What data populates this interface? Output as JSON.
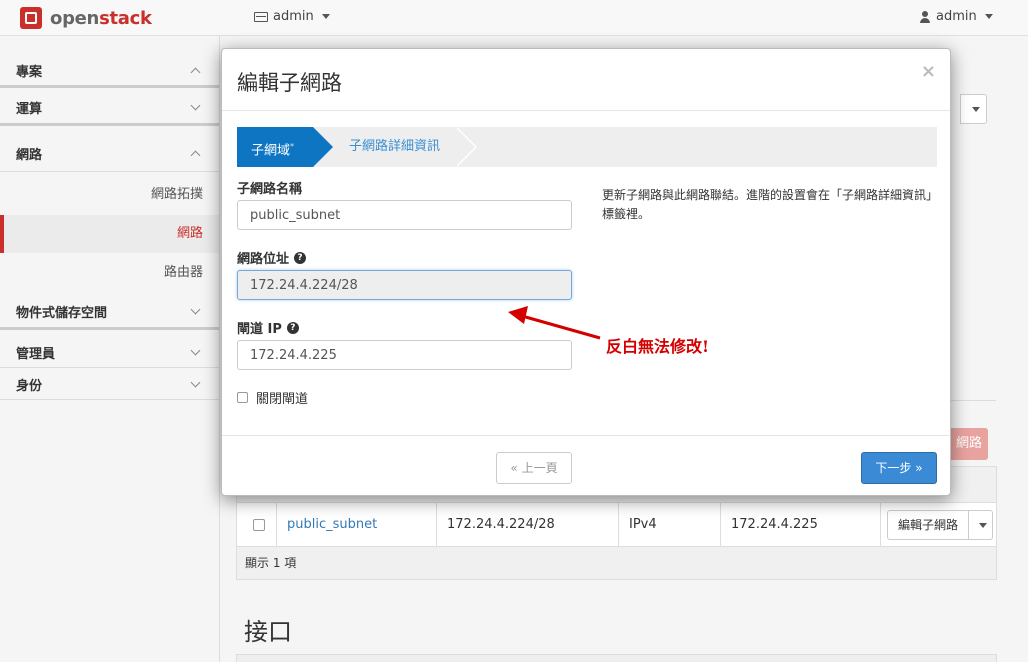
{
  "navbar": {
    "brand_prefix": "open",
    "brand_suffix": "stack",
    "project_label": "admin",
    "user_label": "admin"
  },
  "sidebar": {
    "groups": [
      {
        "label": "專案",
        "icon": "chevron-up-icon"
      },
      {
        "label": "運算",
        "icon": "chevron-down-icon"
      },
      {
        "label": "網路",
        "icon": "chevron-up-icon"
      },
      {
        "label": "物件式儲存空間",
        "icon": "chevron-down-icon"
      },
      {
        "label": "管理員",
        "icon": "chevron-down-icon"
      },
      {
        "label": "身份",
        "icon": "chevron-down-icon"
      }
    ],
    "network_items": [
      {
        "label": "網路拓撲",
        "active": false
      },
      {
        "label": "網路",
        "active": true
      },
      {
        "label": "路由器",
        "active": false
      }
    ]
  },
  "background": {
    "action_btn_fragment": "網路",
    "subnet_row": {
      "name": "public_subnet",
      "network_address": "172.24.4.224/28",
      "ip_version": "IPv4",
      "gateway_ip": "172.24.4.225",
      "action_label": "編輯子網路"
    },
    "footer_text": "顯示 1 項",
    "ports_heading": "接口"
  },
  "modal": {
    "title": "編輯子網路",
    "close_label": "×",
    "wizard_steps": [
      {
        "label": "子網域",
        "active": true,
        "required_mark": "*"
      },
      {
        "label": "子網路詳細資訊",
        "active": false
      }
    ],
    "fields": {
      "subnet_name": {
        "label": "子網路名稱",
        "value": "public_subnet"
      },
      "network_address": {
        "label": "網路位址",
        "value": "172.24.4.224/28",
        "disabled": true
      },
      "gateway_ip": {
        "label": "閘道 IP",
        "value": "172.24.4.225"
      },
      "disable_gateway": {
        "label": "關閉閘道",
        "checked": false
      }
    },
    "help_text": "更新子網路與此網路聯結。進階的設置會在「子網路詳細資訊」標籤裡。",
    "buttons": {
      "prev": "« 上一頁",
      "next": "下一步 »"
    }
  },
  "annotation": {
    "text": "反白無法修改!",
    "color": "#d40000"
  },
  "colors": {
    "brand_red": "#c9302c",
    "wizard_active": "#0e75c3",
    "primary_button": "#3a8ad6"
  }
}
